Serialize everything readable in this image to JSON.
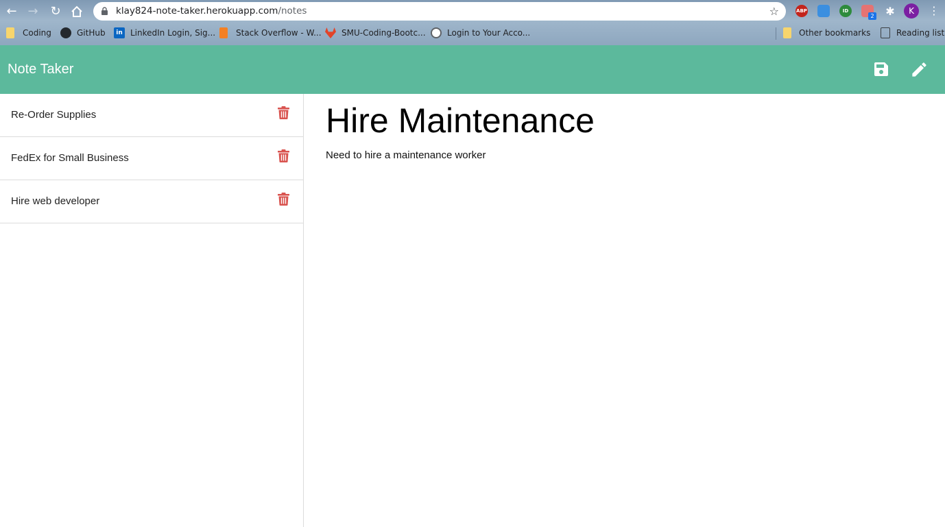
{
  "browser": {
    "url_host": "klay824-note-taker.herokuapp.com",
    "url_path": "/notes",
    "profile_initial": "K",
    "extensions": [
      {
        "name": "abp-icon",
        "label": "ABP",
        "color": "#c3241c"
      },
      {
        "name": "cloud-extension-icon",
        "label": "",
        "color": "#3b8fe0"
      },
      {
        "name": "id-extension-icon",
        "label": "ID",
        "color": "#2e8b3d"
      },
      {
        "name": "cast-extension-icon",
        "label": "",
        "color": "#e57373"
      }
    ],
    "extension_badge": "2",
    "bookmarks": [
      {
        "label": "Coding",
        "icon": "folder-icon"
      },
      {
        "label": "GitHub",
        "icon": "github-icon"
      },
      {
        "label": "LinkedIn Login, Sig...",
        "icon": "linkedin-icon"
      },
      {
        "label": "Stack Overflow - W...",
        "icon": "stackoverflow-icon"
      },
      {
        "label": "SMU-Coding-Bootc...",
        "icon": "gitlab-icon"
      },
      {
        "label": "Login to Your Acco...",
        "icon": "globe-icon"
      }
    ],
    "other_bookmarks": "Other bookmarks",
    "reading_list": "Reading list"
  },
  "app": {
    "brand": "Note Taker",
    "accent_color": "#5cb99c",
    "delete_color": "#d9534f"
  },
  "notes": [
    {
      "title": "Re-Order Supplies"
    },
    {
      "title": "FedEx for Small Business"
    },
    {
      "title": "Hire web developer"
    }
  ],
  "active_note": {
    "title": "Hire Maintenance",
    "text": "Need to hire a maintenance worker"
  }
}
